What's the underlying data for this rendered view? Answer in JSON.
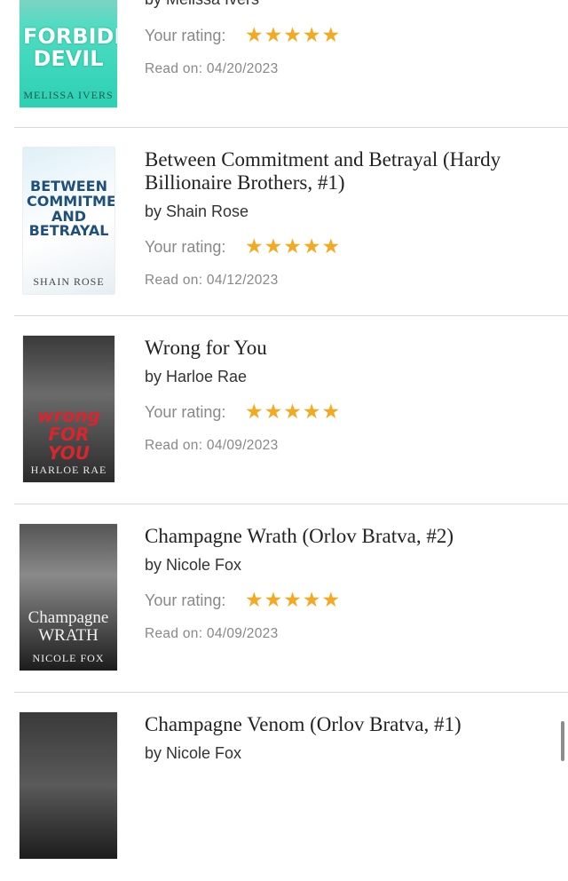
{
  "books": [
    {
      "title": "",
      "author": "by Melissa Ivers",
      "rating_label": "Your rating:",
      "stars": "★★★★★",
      "read_on": "Read on: 04/20/2023",
      "cover": {
        "text": "FORBIDDEN\nDEVIL",
        "author": "MELISSA IVERS",
        "bg": "#2fd3b8",
        "fg": "#ffffff"
      }
    },
    {
      "title": "Between Commitment and Betrayal (Hardy Billionaire Brothers, #1)",
      "author": "by Shain Rose",
      "rating_label": "Your rating:",
      "stars": "★★★★★",
      "read_on": "Read on: 04/12/2023",
      "cover": {
        "text": "BETWEEN\nCOMMITMENT\nAND\nBETRAYAL",
        "author": "SHAIN ROSE",
        "bg": "#eef3f6",
        "fg": "#1f4f7a"
      }
    },
    {
      "title": "Wrong for You",
      "author": "by Harloe Rae",
      "rating_label": "Your rating:",
      "stars": "★★★★★",
      "read_on": "Read on: 04/09/2023",
      "cover": {
        "text": "wrong\nFOR YOU",
        "author": "HARLOE RAE",
        "bg": "#2b2b2b",
        "fg": "#d8262c"
      }
    },
    {
      "title": "Champagne Wrath (Orlov Bratva, #2)",
      "author": "by Nicole Fox",
      "rating_label": "Your rating:",
      "stars": "★★★★★",
      "read_on": "Read on: 04/09/2023",
      "cover": {
        "text": "Champagne\nWRATH",
        "author": "NICOLE FOX",
        "bg": "#1e1e1e",
        "fg": "#f2f2f2"
      }
    },
    {
      "title": "Champagne Venom (Orlov Bratva, #1)",
      "author": "by Nicole Fox",
      "rating_label": "",
      "stars": "",
      "read_on": "",
      "cover": {
        "text": "",
        "author": "",
        "bg": "#2a2a2a",
        "fg": "#f2f2f2"
      }
    }
  ],
  "colors": {
    "star": "#f4a922",
    "separator": "#d8d8d8"
  }
}
